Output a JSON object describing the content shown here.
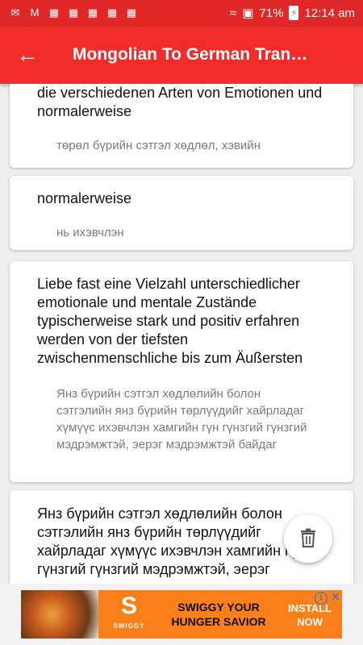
{
  "status_bar": {
    "battery": "71%",
    "time": "12:14 am",
    "icons": [
      "notification-icon",
      "gmail-icon",
      "chart-icon",
      "chart-icon",
      "chart-icon",
      "chart-icon",
      "chart-icon",
      "wifi-icon",
      "no-sim-icon",
      "battery-charging-icon"
    ]
  },
  "app_bar": {
    "title": "Mongolian To German Tran…",
    "back_icon": "arrow-back-icon",
    "background": "#f22b2b"
  },
  "history": [
    {
      "source": "die verschiedenen Arten von Emotionen und normalerweise",
      "translation": "төрөл бүрийн сэтгэл хөдлөл, хэвийн"
    },
    {
      "source": "normalerweise",
      "translation": "нь ихэвчлэн"
    },
    {
      "source": "Liebe fast eine Vielzahl unterschiedlicher emotionale und mentale Zustände typischerweise stark und positiv erfahren werden von der tiefsten zwischenmenschliche bis zum Äußersten",
      "translation": "Янз бүрийн сэтгэл хөдлөлийн болон сэтгэлийн янз бүрийн төрлүүдийг хайрладаг хүмүүс ихэвчлэн хамгийн гүн гүнзгий гүнзгий мэдрэмжтэй, эерэг мэдрэмжтэй байдаг"
    },
    {
      "source": "Янз бүрийн сэтгэл хөдлөлийн болон сэтгэлийн янз бүрийн төрлүүдийг хайрладаг хүмүүс ихэвчлэн хамгийн гүн гүнзгий гүнзгий мэдрэмжтэй, эерэг",
      "translation": ""
    }
  ],
  "fab": {
    "icon": "trash-icon"
  },
  "ad": {
    "brand": "SWIGGY",
    "logo": "S",
    "headline": "SWIGGY YOUR HUNGER SAVIOR",
    "cta": "INSTALL NOW",
    "info_icon": "info-icon",
    "close_icon": "close-icon",
    "brand_color": "#fc8019"
  }
}
